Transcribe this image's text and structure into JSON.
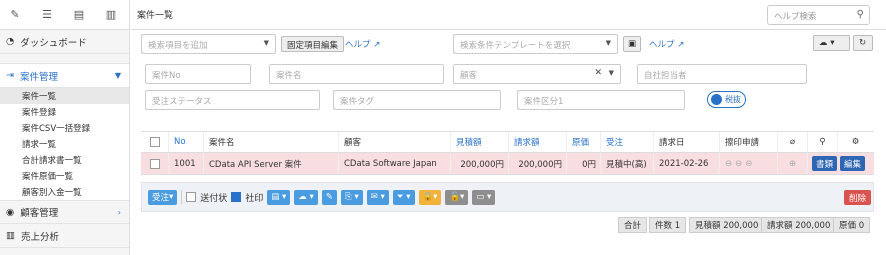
{
  "sidebar": {
    "top_icons": [
      "pencil-icon",
      "list-icon",
      "table-icon",
      "bar-chart-icon"
    ],
    "dashboard_label": "ダッシュボード",
    "case_mgmt_label": "案件管理",
    "sub_items": [
      "案件一覧",
      "案件登録",
      "案件CSV一括登録",
      "請求一覧",
      "合計請求書一覧",
      "案件原価一覧",
      "顧客別入金一覧"
    ],
    "customer_mgmt_label": "顧客管理",
    "sales_label": "売上分析"
  },
  "header": {
    "title": "案件一覧",
    "help_search_placeholder": "ヘルプ検索"
  },
  "filters": {
    "add_field_placeholder": "検索項目を追加",
    "fixed_edit_label": "固定項目編集",
    "help_label": "ヘルプ",
    "template_placeholder": "検索条件テンプレートを選択",
    "help2_label": "ヘルプ",
    "case_no": "案件No",
    "case_name": "案件名",
    "customer": "顧客",
    "owner": "自社担当者",
    "order_status": "受注ステータス",
    "case_tag": "案件タグ",
    "case_category": "案件区分1",
    "pill_label": "税抜"
  },
  "table": {
    "headers": [
      "No",
      "案件名",
      "顧客",
      "見積額",
      "請求額",
      "原価",
      "受注",
      "請求日",
      "擦印申請"
    ],
    "row": {
      "no": "1001",
      "name": "CData API Server 案件",
      "customer": "CData Software Japan",
      "estimate": "200,000円",
      "billing": "200,000円",
      "cost": "0円",
      "order": "見積中(高)",
      "date": "2021-02-26",
      "btn1": "書類",
      "btn2": "編集"
    }
  },
  "toolbar": {
    "order_label": "受注",
    "sent_label": "送付状",
    "company_stamp_label": "社印",
    "delete_label": "削除"
  },
  "summary": {
    "total": "合計",
    "count": "件数 1",
    "estimate": "見積額 200,000",
    "billing": "請求額 200,000",
    "cost": "原価 0"
  }
}
